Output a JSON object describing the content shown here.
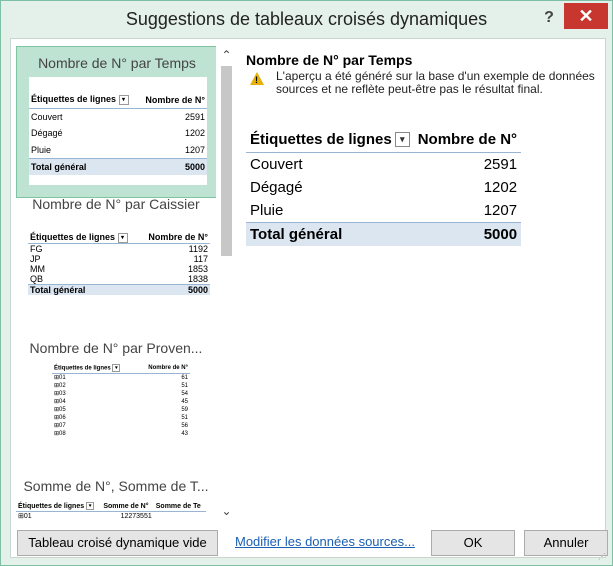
{
  "window": {
    "title": "Suggestions de tableaux croisés dynamiques",
    "help_label": "?",
    "close_label": "✕"
  },
  "thumbnails": [
    {
      "title": "Nombre de N° par Temps",
      "header": [
        "Étiquettes de lignes",
        "Nombre de N°"
      ],
      "rows": [
        [
          "Couvert",
          "2591"
        ],
        [
          "Dégagé",
          "1202"
        ],
        [
          "Pluie",
          "1207"
        ]
      ],
      "total": [
        "Total général",
        "5000"
      ]
    },
    {
      "title": "Nombre de N° par Caissier",
      "header": [
        "Étiquettes de lignes",
        "Nombre de N°"
      ],
      "rows": [
        [
          "FG",
          "1192"
        ],
        [
          "JP",
          "117"
        ],
        [
          "MM",
          "1853"
        ],
        [
          "QB",
          "1838"
        ]
      ],
      "total": [
        "Total général",
        "5000"
      ]
    },
    {
      "title": "Nombre de N° par Proven...",
      "header": [
        "Étiquettes de lignes",
        "Nombre de N°"
      ],
      "rows": [
        [
          "⊞01",
          "61"
        ],
        [
          "⊞02",
          "51"
        ],
        [
          "⊞03",
          "54"
        ],
        [
          "⊞04",
          "45"
        ],
        [
          "⊞05",
          "59"
        ],
        [
          "⊞06",
          "51"
        ],
        [
          "⊞07",
          "56"
        ],
        [
          "⊞08",
          "43"
        ]
      ]
    },
    {
      "title": "Somme de N°, Somme de T...",
      "header": [
        "Étiquettes de lignes",
        "Somme de N°",
        "Somme de Te"
      ],
      "rows": [
        [
          "⊞01",
          "12273551",
          ""
        ]
      ]
    }
  ],
  "preview": {
    "title": "Nombre de N° par Temps",
    "warning": "L'aperçu a été généré sur la base d'un exemple de données sources et ne reflète peut-être pas le résultat final.",
    "header": [
      "Étiquettes de lignes",
      "Nombre de N°"
    ],
    "rows": [
      [
        "Couvert",
        "2591"
      ],
      [
        "Dégagé",
        "1202"
      ],
      [
        "Pluie",
        "1207"
      ]
    ],
    "total": [
      "Total général",
      "5000"
    ]
  },
  "footer": {
    "blank_pivot": "Tableau croisé dynamique vide",
    "modify_link": "Modifier les données sources...",
    "ok": "OK",
    "cancel": "Annuler"
  },
  "colors": {
    "accent": "#bfe3d2",
    "close": "#c7372f",
    "link": "#1a5fb4",
    "total_bg": "#dce6f1"
  }
}
